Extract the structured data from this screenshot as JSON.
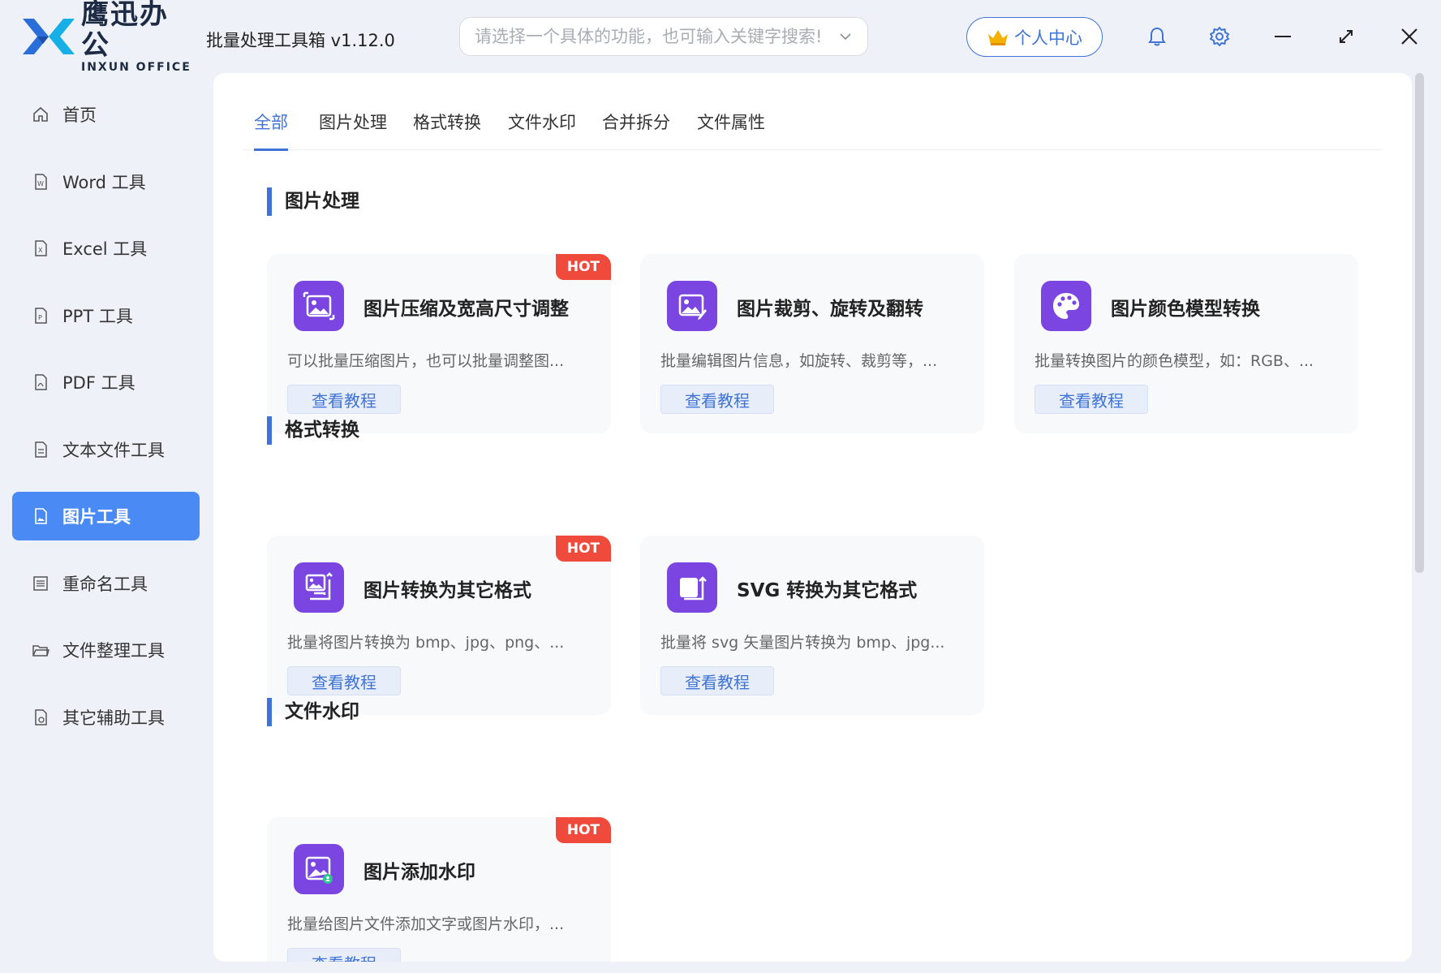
{
  "app": {
    "logo_cn": "鹰迅办公",
    "logo_en": "INXUN OFFICE",
    "title": "批量处理工具箱 v1.12.0"
  },
  "search": {
    "placeholder": "请选择一个具体的功能，也可输入关键字搜索!"
  },
  "header": {
    "user_center": "个人中心"
  },
  "colors": {
    "accent": "#3f74d6",
    "sidebar_active": "#4a8af4",
    "hot": "#f04a3c",
    "icon_bg": "#7a45e0"
  },
  "sidebar": {
    "items": [
      {
        "label": "首页",
        "icon": "home-icon"
      },
      {
        "label": "Word 工具",
        "icon": "word-file-icon"
      },
      {
        "label": "Excel 工具",
        "icon": "excel-file-icon"
      },
      {
        "label": "PPT 工具",
        "icon": "ppt-file-icon"
      },
      {
        "label": "PDF 工具",
        "icon": "pdf-file-icon"
      },
      {
        "label": "文本文件工具",
        "icon": "text-file-icon"
      },
      {
        "label": "图片工具",
        "icon": "image-file-icon",
        "active": true
      },
      {
        "label": "重命名工具",
        "icon": "rename-icon"
      },
      {
        "label": "文件整理工具",
        "icon": "folder-icon"
      },
      {
        "label": "其它辅助工具",
        "icon": "tools-icon"
      }
    ]
  },
  "tabs": [
    {
      "label": "全部",
      "active": true
    },
    {
      "label": "图片处理"
    },
    {
      "label": "格式转换"
    },
    {
      "label": "文件水印"
    },
    {
      "label": "合并拆分"
    },
    {
      "label": "文件属性"
    }
  ],
  "sections": [
    {
      "title": "图片处理",
      "cards": [
        {
          "title": "图片压缩及宽高尺寸调整",
          "desc": "可以批量压缩图片，也可以批量调整图...",
          "button": "查看教程",
          "hot": "HOT"
        },
        {
          "title": "图片裁剪、旋转及翻转",
          "desc": "批量编辑图片信息，如旋转、裁剪等，...",
          "button": "查看教程"
        },
        {
          "title": "图片颜色模型转换",
          "desc": "批量转换图片的颜色模型，如：RGB、...",
          "button": "查看教程"
        }
      ]
    },
    {
      "title": "格式转换",
      "cards": [
        {
          "title": "图片转换为其它格式",
          "desc": "批量将图片转换为 bmp、jpg、png、...",
          "button": "查看教程",
          "hot": "HOT"
        },
        {
          "title": "SVG 转换为其它格式",
          "desc": "批量将 svg 矢量图片转换为 bmp、jpg...",
          "button": "查看教程"
        }
      ]
    },
    {
      "title": "文件水印",
      "cards": [
        {
          "title": "图片添加水印",
          "desc": "批量给图片文件添加文字或图片水印，...",
          "button": "查看教程",
          "hot": "HOT"
        }
      ]
    }
  ]
}
